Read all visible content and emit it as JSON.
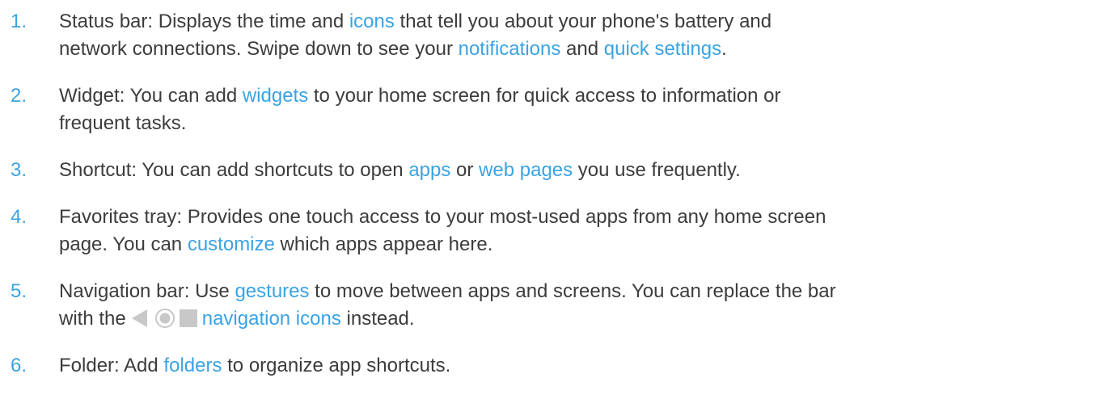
{
  "items": [
    {
      "number": "1.",
      "line1": {
        "t1": "Status bar: Displays the time and ",
        "link1": "icons",
        "t2": " that tell you about your phone's battery and"
      },
      "line2": {
        "t1": "network connections. Swipe down to see your ",
        "link1": "notifications",
        "t2": " and ",
        "link2": "quick settings",
        "t3": "."
      }
    },
    {
      "number": "2.",
      "line1": {
        "t1": "Widget: You can add ",
        "link1": "widgets",
        "t2": " to your home screen for quick access to information or"
      },
      "line2": {
        "t1": "frequent tasks."
      }
    },
    {
      "number": "3.",
      "line1": {
        "t1": "Shortcut: You can add shortcuts to open ",
        "link1": "apps",
        "t2": " or ",
        "link2": "web pages",
        "t3": " you use frequently."
      }
    },
    {
      "number": "4.",
      "line1": {
        "t1": "Favorites tray: Provides one touch access to your most-used apps from any home screen"
      },
      "line2": {
        "t1": "page. You can ",
        "link1": "customize",
        "t2": " which apps appear here."
      }
    },
    {
      "number": "5.",
      "line1": {
        "t1": "Navigation bar: Use ",
        "link1": "gestures",
        "t2": " to move between apps and screens. You can replace the bar"
      },
      "line2": {
        "t1": "with the",
        "link1": "navigation icons",
        "t2": " instead."
      }
    },
    {
      "number": "6.",
      "line1": {
        "t1": "Folder: Add ",
        "link1": "folders",
        "t2": " to organize app shortcuts."
      }
    }
  ],
  "icons": [
    "back-triangle-icon",
    "home-circle-icon",
    "recents-square-icon"
  ],
  "colors": {
    "link": "#3aa3e3",
    "text": "#3c3c3c",
    "icon": "#c8c8c8"
  }
}
